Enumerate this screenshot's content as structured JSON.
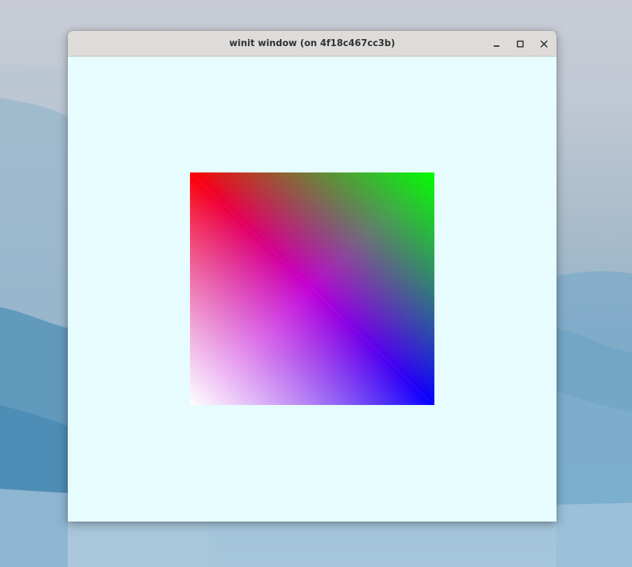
{
  "window": {
    "title": "winit window (on 4f18c467cc3b)",
    "buttons": {
      "minimize_icon": "minimize-icon",
      "maximize_icon": "maximize-icon",
      "close_icon": "close-icon"
    },
    "background_color": "#e6fcfe"
  },
  "render": {
    "corner_colors": {
      "top_left": "#ff0000",
      "top_right": "#00ff00",
      "bottom_right": "#0000ff",
      "bottom_left": "#ffffff"
    },
    "diagonal_color": "#c000e0"
  }
}
